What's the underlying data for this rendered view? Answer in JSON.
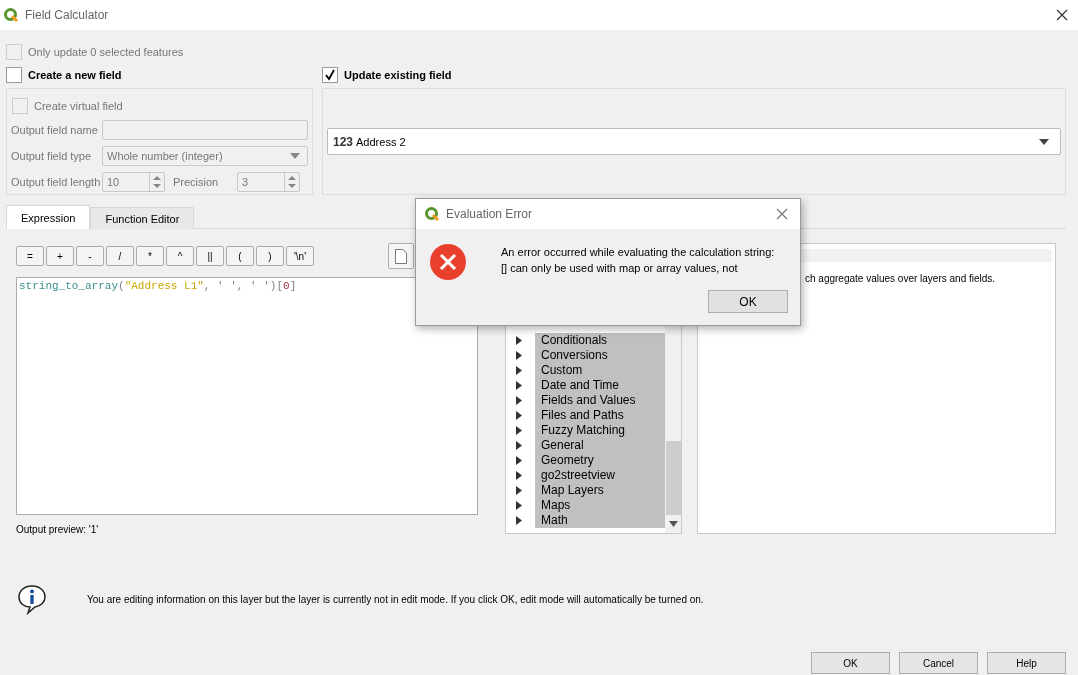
{
  "window": {
    "title": "Field Calculator"
  },
  "only_update": {
    "label": "Only update 0 selected features",
    "checked": false,
    "disabled": true
  },
  "create_new": {
    "label": "Create a new field",
    "checked": false
  },
  "update_existing": {
    "label": "Update existing field",
    "checked": true
  },
  "new_field": {
    "virtual": {
      "label": "Create virtual field",
      "checked": false
    },
    "name_label": "Output field name",
    "type_label": "Output field type",
    "type_value": "Whole number (integer)",
    "length_label": "Output field length",
    "length_value": "10",
    "precision_label": "Precision",
    "precision_value": "3"
  },
  "existing_field": {
    "type_badge": "123",
    "value": "Address 2"
  },
  "tabs": [
    {
      "label": "Expression",
      "selected": true
    },
    {
      "label": "Function Editor",
      "selected": false
    }
  ],
  "operators": [
    "=",
    "+",
    "-",
    "/",
    "*",
    "^",
    "||",
    "(",
    ")",
    "'\\n'"
  ],
  "expression": [
    {
      "text": "string_to_array",
      "kind": "function"
    },
    {
      "text": "(",
      "kind": "plain"
    },
    {
      "text": "\"Address L1\"",
      "kind": "field"
    },
    {
      "text": ", ' ', ' ')[",
      "kind": "plain"
    },
    {
      "text": "0",
      "kind": "number"
    },
    {
      "text": "]",
      "kind": "plain"
    }
  ],
  "output_preview": {
    "label": "Output preview:",
    "value": "'1'"
  },
  "functions": [
    {
      "label": "Conditionals",
      "expanded": false
    },
    {
      "label": "Conversions",
      "expanded": false
    },
    {
      "label": "Custom",
      "expanded": false
    },
    {
      "label": "Date and Time",
      "expanded": false
    },
    {
      "label": "Fields and Values",
      "expanded": false
    },
    {
      "label": "Files and Paths",
      "expanded": false
    },
    {
      "label": "Fuzzy Matching",
      "expanded": false
    },
    {
      "label": "General",
      "expanded": false
    },
    {
      "label": "Geometry",
      "expanded": false
    },
    {
      "label": "go2streetview",
      "expanded": false
    },
    {
      "label": "Map Layers",
      "expanded": false
    },
    {
      "label": "Maps",
      "expanded": false
    },
    {
      "label": "Math",
      "expanded": false
    }
  ],
  "help": {
    "text": "ch aggregate values over layers and fields."
  },
  "error_dialog": {
    "title": "Evaluation Error",
    "lines": [
      "An error occurred while evaluating the calculation string:",
      "[] can only be used with map or array values, not"
    ],
    "button": "OK"
  },
  "info": {
    "text": "You are editing information on this layer but the layer is currently not in edit mode. If you click OK, edit mode will automatically be turned on."
  },
  "buttons": [
    "OK",
    "Cancel",
    "Help"
  ]
}
